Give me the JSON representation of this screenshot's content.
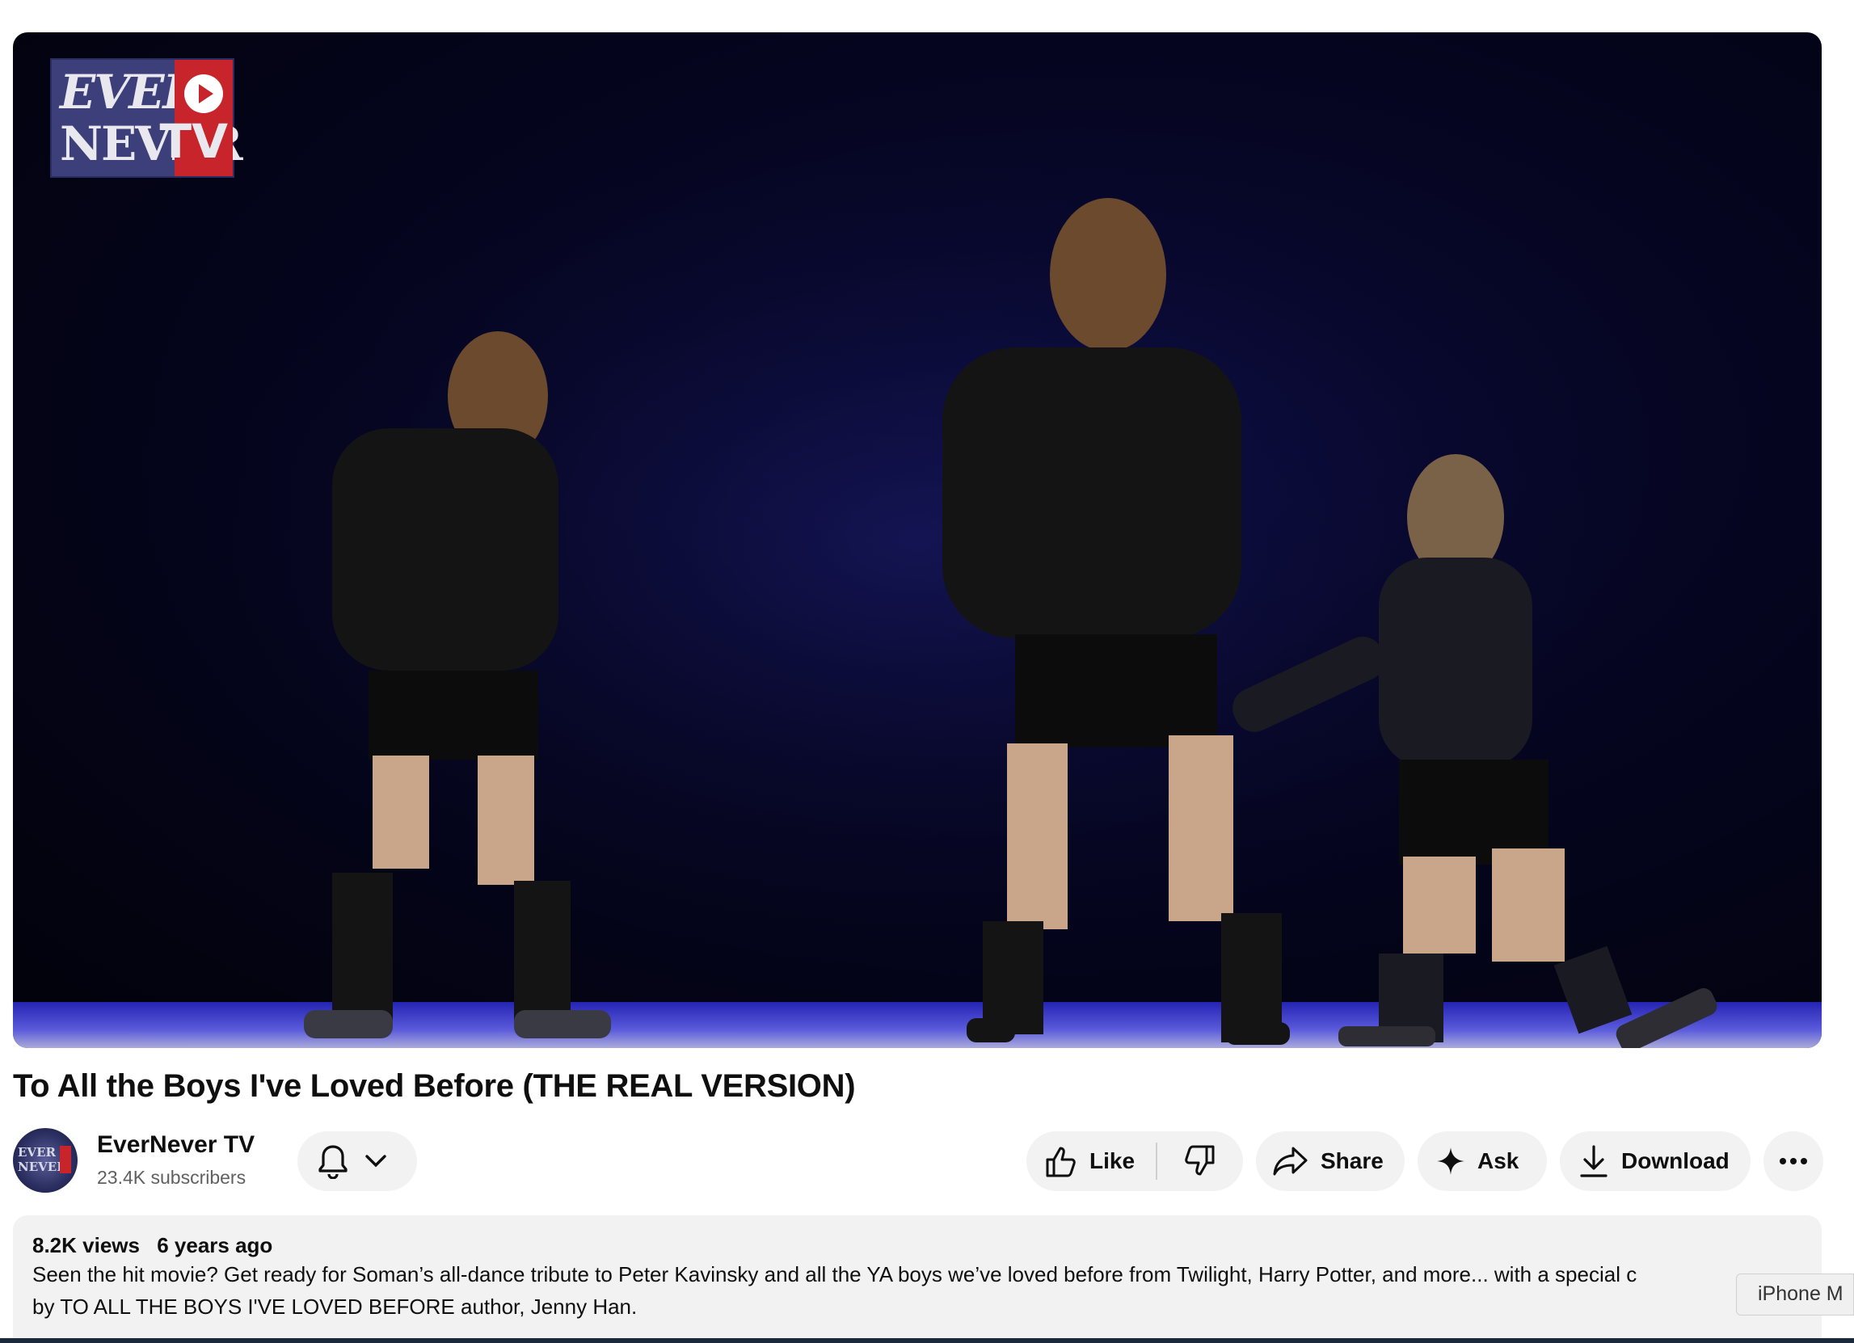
{
  "video": {
    "logo_line1": "EVER",
    "logo_line2": "NEVER",
    "logo_tv": "TV",
    "title": "To All the Boys I've Loved Before (THE REAL VERSION)"
  },
  "channel": {
    "name": "EverNever TV",
    "subscribers": "23.4K subscribers",
    "avatar_text_1": "EVER",
    "avatar_text_2": "NEVER"
  },
  "actions": {
    "like_label": "Like",
    "share_label": "Share",
    "ask_label": "Ask",
    "download_label": "Download"
  },
  "description": {
    "views": "8.2K views",
    "age": "6 years ago",
    "line1": "Seen the hit movie? Get ready for Soman’s all-dance tribute to Peter Kavinsky and all the YA boys we’ve loved before from Twilight, Harry Potter, and more... with a special c",
    "line2": "by TO ALL THE BOYS I'VE LOVED BEFORE author, Jenny Han."
  },
  "tooltip": {
    "text": "iPhone M"
  },
  "icons": [
    "bell-icon",
    "chevron-down-icon",
    "thumbs-up-icon",
    "thumbs-down-icon",
    "share-icon",
    "sparkle-icon",
    "download-icon",
    "more-icon"
  ]
}
